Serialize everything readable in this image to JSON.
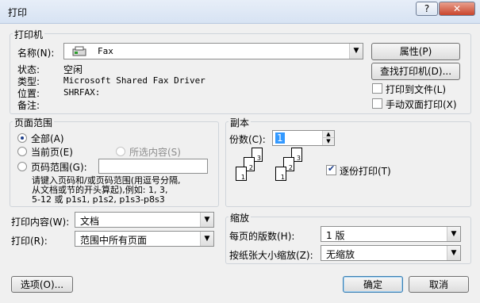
{
  "window": {
    "title": "打印",
    "help_label": "?",
    "close_label": "✕"
  },
  "printer": {
    "group_label": "打印机",
    "name_label": "名称(N):",
    "name_value": "Fax",
    "status_label": "状态:",
    "status_value": "空闲",
    "type_label": "类型:",
    "type_value": "Microsoft Shared Fax Driver",
    "location_label": "位置:",
    "location_value": "SHRFAX:",
    "comment_label": "备注:",
    "properties_button": "属性(P)",
    "find_printer_button": "查找打印机(D)...",
    "print_to_file_label": "打印到文件(L)",
    "manual_duplex_label": "手动双面打印(X)"
  },
  "page_range": {
    "group_label": "页面范围",
    "all_label": "全部(A)",
    "current_page_label": "当前页(E)",
    "selection_label": "所选内容(S)",
    "pages_label": "页码范围(G):",
    "pages_value": "",
    "hint_line1": "请键入页码和/或页码范围(用逗号分隔,",
    "hint_line2": "从文档或节的开头算起),例如: 1, 3,",
    "hint_line3": "5-12 或 p1s1, p1s2, p1s3-p8s3"
  },
  "copies": {
    "group_label": "副本",
    "count_label": "份数(C):",
    "count_value": "1",
    "collate_label": "逐份打印(T)"
  },
  "print_what": {
    "label": "打印内容(W):",
    "value": "文档"
  },
  "print": {
    "label": "打印(R):",
    "value": "范围中所有页面"
  },
  "zoom": {
    "group_label": "缩放",
    "pages_per_sheet_label": "每页的版数(H):",
    "pages_per_sheet_value": "1 版",
    "scale_label": "按纸张大小缩放(Z):",
    "scale_value": "无缩放"
  },
  "footer": {
    "options_button": "选项(O)...",
    "ok_button": "确定",
    "cancel_button": "取消"
  },
  "icons": {
    "printer": "fax-printer-icon",
    "dropdown": "chevron-down-icon",
    "spin_up": "spin-up-icon",
    "spin_down": "spin-down-icon",
    "check": "checkmark-icon"
  },
  "colors": {
    "window_bg": "#f0f0f0",
    "accent": "#3c7fb1",
    "close_red": "#c9452c",
    "selection_blue": "#3399ff"
  }
}
